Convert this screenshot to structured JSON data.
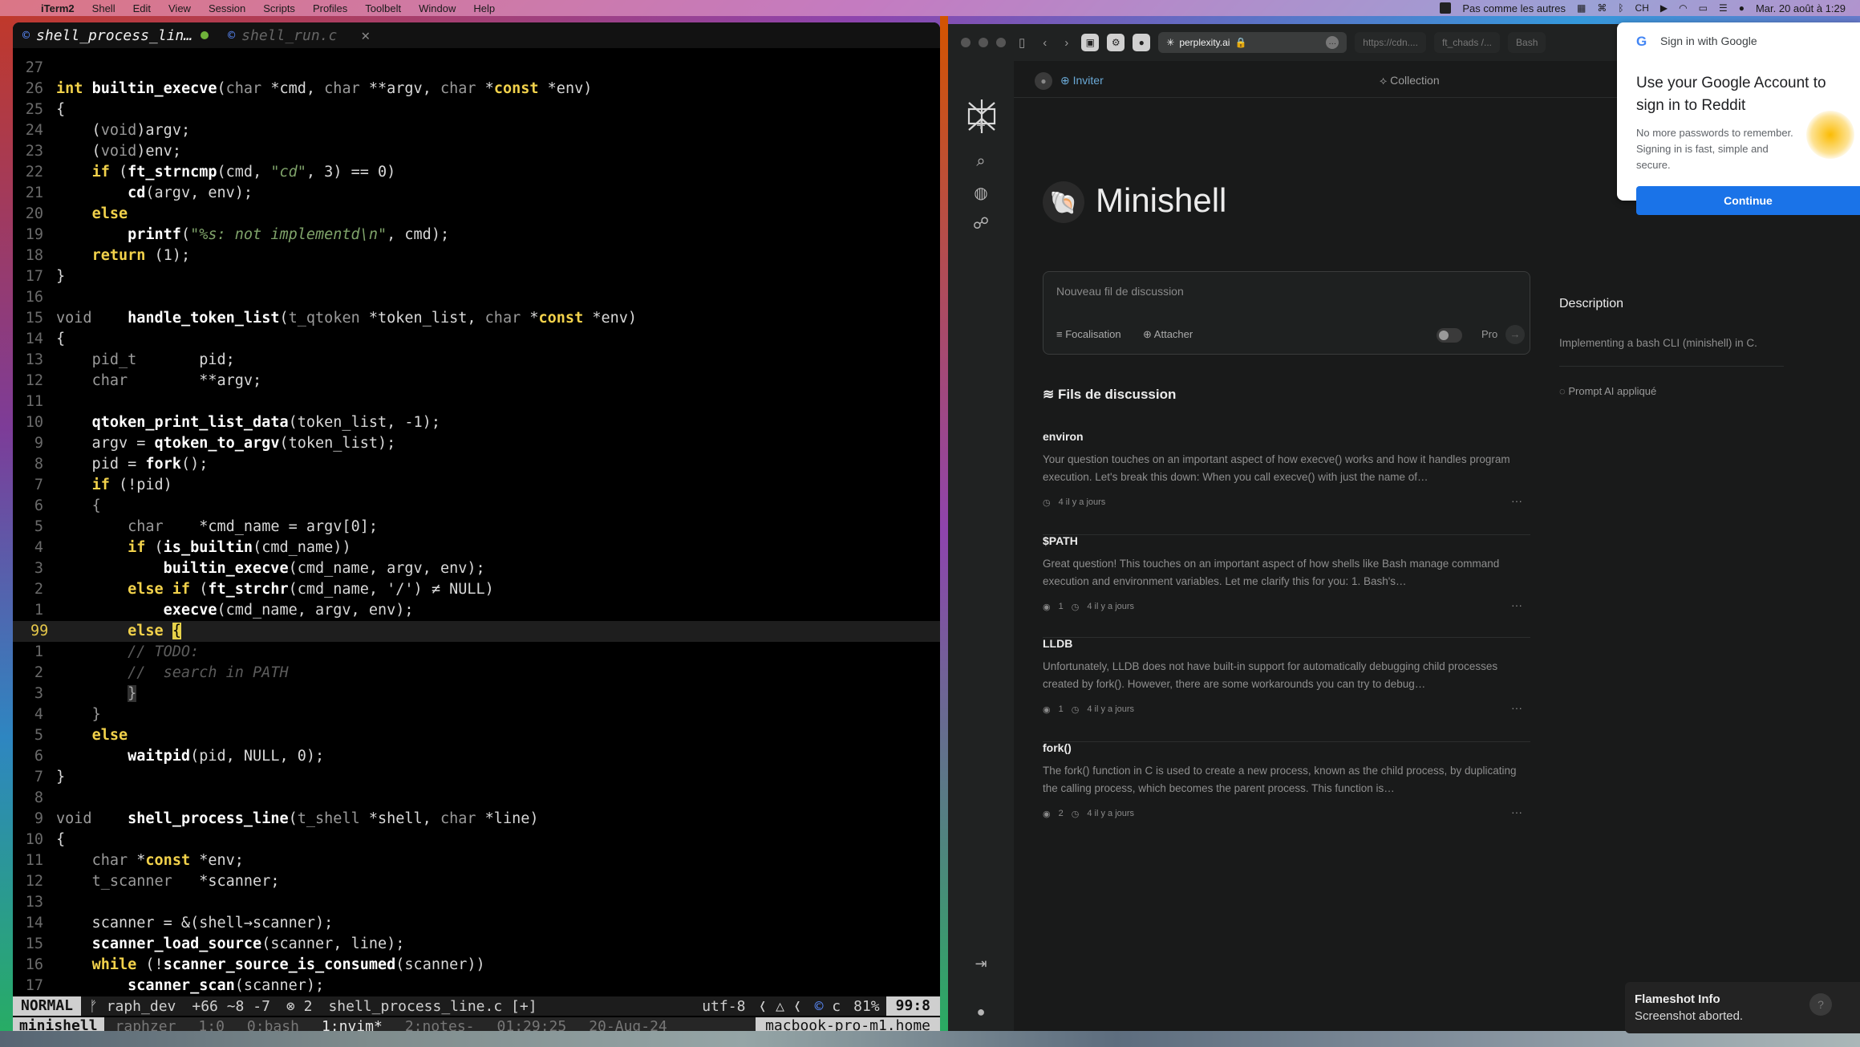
{
  "menubar": {
    "app_name": "iTerm2",
    "items": [
      "Shell",
      "Edit",
      "View",
      "Session",
      "Scripts",
      "Profiles",
      "Toolbelt",
      "Window",
      "Help"
    ],
    "now_playing": "Pas comme les autres",
    "date_time": "Mar. 20 août à 1:29"
  },
  "nvim": {
    "tabs": [
      {
        "name": "shell_process_lin…",
        "active": true
      },
      {
        "name": "shell_run.c",
        "active": false
      }
    ],
    "statusline": {
      "mode": "NORMAL",
      "branch": "raph_dev",
      "diff": "+66 ~8 -7",
      "errors": "2",
      "file": "shell_process_line.c [+]",
      "encoding": "utf-8",
      "filetype": "c",
      "percent": "81%",
      "position": "99:8"
    },
    "tmux": {
      "session": "minishell",
      "user": "raphzer",
      "windows": [
        "1:0",
        "0:bash",
        "1:nvim*",
        "2:notes-"
      ],
      "time": "01:29:25",
      "date": "20-Aug-24",
      "host": "macbook-pro-m1.home"
    }
  },
  "browser": {
    "active_tab": "perplexity.ai",
    "other_tabs": [
      "https://cdn....",
      "ft_chads /...",
      "Bash"
    ],
    "invite": "Inviter",
    "collection": "Collection",
    "space_title": "Minishell",
    "new_thread_placeholder": "Nouveau fil de discussion",
    "focus": "Focalisation",
    "attach": "Attacher",
    "pro": "Pro",
    "threads_heading": "Fils de discussion",
    "threads": [
      {
        "title": "environ",
        "preview": "Your question touches on an important aspect of how execve() works and how it handles program execution. Let's break this down: When you call execve() with just the name of…",
        "views": "",
        "age": "4 il y a jours"
      },
      {
        "title": "$PATH",
        "preview": "Great question! This touches on an important aspect of how shells like Bash manage command execution and environment variables. Let me clarify this for you: 1. Bash's…",
        "views": "1",
        "age": "4 il y a jours"
      },
      {
        "title": "LLDB",
        "preview": "Unfortunately, LLDB does not have built-in support for automatically debugging child processes created by fork(). However, there are some workarounds you can try to debug…",
        "views": "1",
        "age": "4 il y a jours"
      },
      {
        "title": "fork()",
        "preview": "The fork() function in C is used to create a new process, known as the child process, by duplicating the calling process, which becomes the parent process. This function is…",
        "views": "2",
        "age": "4 il y a jours"
      }
    ],
    "description_heading": "Description",
    "description": "Implementing a bash CLI (minishell) in C.",
    "prompt_applied": "Prompt AI appliqué"
  },
  "google_popup": {
    "header": "Sign in with Google",
    "title": "Use your Google Account to sign in to Reddit",
    "body": "No more passwords to remember. Signing in is fast, simple and secure.",
    "button": "Continue"
  },
  "flameshot": {
    "title": "Flameshot Info",
    "message": "Screenshot aborted."
  },
  "colors": {
    "keyword": "#f2d24b",
    "string": "#7fa36a",
    "comment": "#5c5c5c",
    "google_blue": "#1a73e8"
  }
}
